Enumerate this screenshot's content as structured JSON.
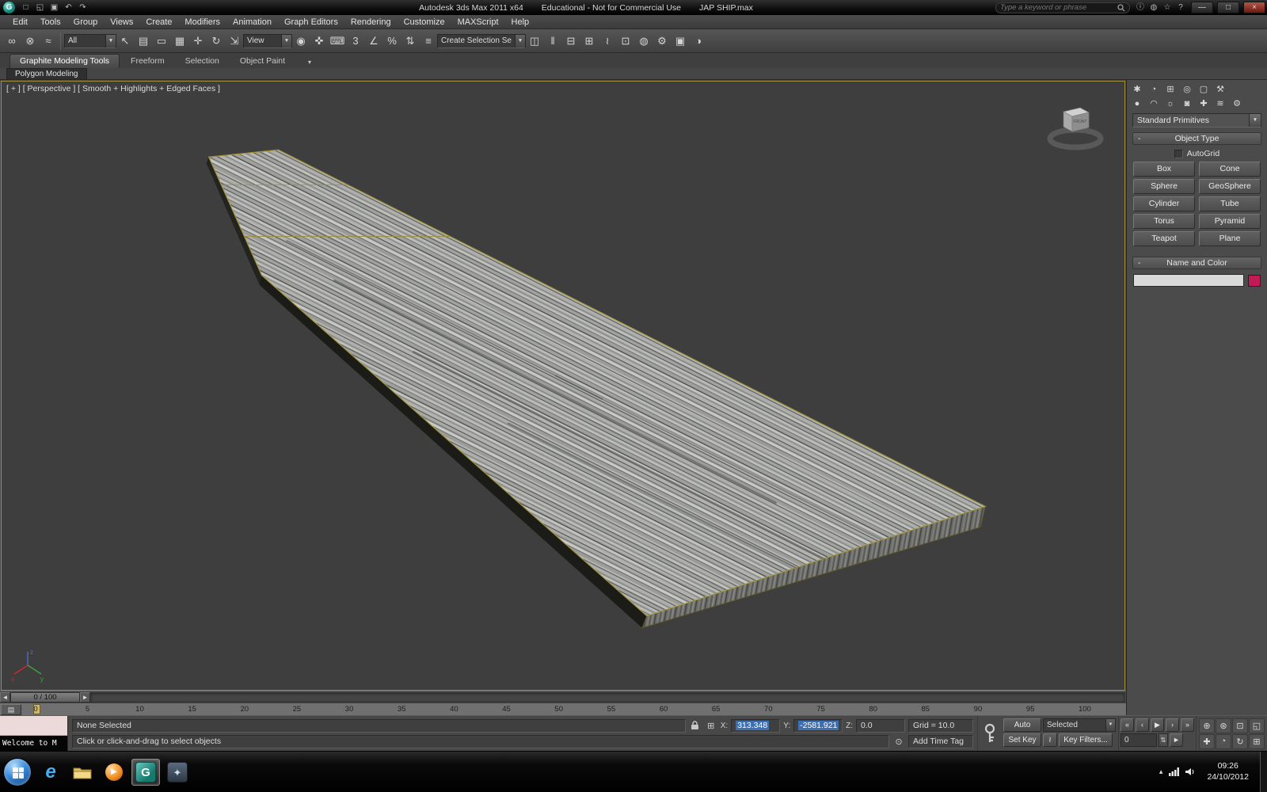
{
  "title_bar": {
    "app_title": "Autodesk 3ds Max 2011 x64",
    "license_text": "Educational - Not for Commercial Use",
    "file_name": "JAP SHIP.max",
    "search_placeholder": "Type a keyword or phrase",
    "window_buttons": {
      "minimize": "—",
      "maximize": "□",
      "close": "×"
    },
    "qa_icons": [
      {
        "name": "new-scene-icon",
        "glyph": "□"
      },
      {
        "name": "open-file-icon",
        "glyph": "◱"
      },
      {
        "name": "save-file-icon",
        "glyph": "▣"
      },
      {
        "name": "undo-icon",
        "glyph": "↶"
      },
      {
        "name": "redo-icon",
        "glyph": "↷"
      }
    ],
    "right_icons": [
      {
        "name": "infocenter-icon",
        "glyph": "ⓘ"
      },
      {
        "name": "communication-center-icon",
        "glyph": "◍"
      },
      {
        "name": "favorites-star-icon",
        "glyph": "☆"
      },
      {
        "name": "help-icon",
        "glyph": "?"
      }
    ]
  },
  "menu_bar": {
    "items": [
      "Edit",
      "Tools",
      "Group",
      "Views",
      "Create",
      "Modifiers",
      "Animation",
      "Graph Editors",
      "Rendering",
      "Customize",
      "MAXScript",
      "Help"
    ]
  },
  "toolbar": {
    "selection_filter_value": "All",
    "coord_system_value": "View",
    "named_selection_value": "Create Selection Se",
    "dropdown_arrow": "▼",
    "group1": [
      {
        "name": "select-and-link-icon",
        "glyph": "∞"
      },
      {
        "name": "unlink-selection-icon",
        "glyph": "⊗"
      },
      {
        "name": "bind-to-space-warp-icon",
        "glyph": "≈"
      }
    ],
    "group2": [
      {
        "name": "select-object-icon",
        "glyph": "↖"
      },
      {
        "name": "select-by-name-icon",
        "glyph": "▤"
      },
      {
        "name": "rectangular-selection-region-icon",
        "glyph": "▭"
      },
      {
        "name": "window-crossing-icon",
        "glyph": "▦"
      },
      {
        "name": "select-and-move-icon",
        "glyph": "✛"
      },
      {
        "name": "select-and-rotate-icon",
        "glyph": "↻"
      },
      {
        "name": "select-and-scale-icon",
        "glyph": "⇲"
      }
    ],
    "group3": [
      {
        "name": "use-pivot-point-center-icon",
        "glyph": "◉"
      },
      {
        "name": "select-and-manipulate-icon",
        "glyph": "✜"
      },
      {
        "name": "keyboard-shortcut-override-icon",
        "glyph": "⌨"
      },
      {
        "name": "snap-toggle-3d-icon",
        "glyph": "3"
      },
      {
        "name": "angle-snap-icon",
        "glyph": "∠"
      },
      {
        "name": "percent-snap-icon",
        "glyph": "%"
      },
      {
        "name": "spinner-snap-icon",
        "glyph": "⇅"
      },
      {
        "name": "edit-named-selection-sets-icon",
        "glyph": "≡"
      }
    ],
    "group4": [
      {
        "name": "mirror-icon",
        "glyph": "◫"
      },
      {
        "name": "align-icon",
        "glyph": "‖"
      },
      {
        "name": "layer-manager-icon",
        "glyph": "⊟"
      },
      {
        "name": "graphite-ribbon-toggle-icon",
        "glyph": "⊞"
      },
      {
        "name": "curve-editor-icon",
        "glyph": "≀"
      },
      {
        "name": "schematic-view-icon",
        "glyph": "⊡"
      },
      {
        "name": "material-editor-icon",
        "glyph": "◍"
      },
      {
        "name": "render-setup-icon",
        "glyph": "⚙"
      },
      {
        "name": "rendered-frame-window-icon",
        "glyph": "▣"
      },
      {
        "name": "render-production-icon",
        "glyph": "◑"
      }
    ]
  },
  "ribbon": {
    "tabs": [
      "Graphite Modeling Tools",
      "Freeform",
      "Selection",
      "Object Paint"
    ],
    "more_glyph": "▾",
    "subtab": "Polygon Modeling"
  },
  "viewport": {
    "label": "[ + ] [ Perspective ] [ Smooth + Highlights + Edged Faces ]",
    "viewcube_front_label": "FRONT",
    "axis_x_label": "x",
    "axis_y_label": "y",
    "axis_z_label": "z"
  },
  "command_panel": {
    "tab_icons": [
      {
        "name": "create-tab-icon",
        "glyph": "✱"
      },
      {
        "name": "modify-tab-icon",
        "glyph": "◔"
      },
      {
        "name": "hierarchy-tab-icon",
        "glyph": "⊞"
      },
      {
        "name": "motion-tab-icon",
        "glyph": "◎"
      },
      {
        "name": "display-tab-icon",
        "glyph": "▢"
      },
      {
        "name": "utilities-tab-icon",
        "glyph": "⚒"
      }
    ],
    "category_icons": [
      {
        "name": "geometry-category-icon",
        "glyph": "●"
      },
      {
        "name": "shapes-category-icon",
        "glyph": "◠"
      },
      {
        "name": "lights-category-icon",
        "glyph": "☼"
      },
      {
        "name": "cameras-category-icon",
        "glyph": "◙"
      },
      {
        "name": "helpers-category-icon",
        "glyph": "✚"
      },
      {
        "name": "space-warps-category-icon",
        "glyph": "≋"
      },
      {
        "name": "systems-category-icon",
        "glyph": "⚙"
      }
    ],
    "primitives_dropdown_value": "Standard Primitives",
    "object_type_rollout": {
      "collapse_glyph": "-",
      "title": "Object Type",
      "autogrid_label": "AutoGrid",
      "buttons": [
        "Box",
        "Cone",
        "Sphere",
        "GeoSphere",
        "Cylinder",
        "Tube",
        "Torus",
        "Pyramid",
        "Teapot",
        "Plane"
      ]
    },
    "name_color_rollout": {
      "collapse_glyph": "-",
      "title": "Name and Color",
      "name_value": "",
      "swatch_color": "#c21a57"
    }
  },
  "timeline": {
    "prev_glyph": "◄",
    "next_glyph": "►",
    "frame_display": "0 / 100",
    "ruler_button_glyph": "▤",
    "ticks": [
      "0",
      "5",
      "10",
      "15",
      "20",
      "25",
      "30",
      "35",
      "40",
      "45",
      "50",
      "55",
      "60",
      "65",
      "70",
      "75",
      "80",
      "85",
      "90",
      "95",
      "100"
    ]
  },
  "status_bar": {
    "none_selected": "None Selected",
    "prompt": "Click or click-and-drag to select objects",
    "coord_mode_glyph": "⊞",
    "coord": {
      "x_label": "X:",
      "x_value": "313.348",
      "y_label": "Y:",
      "y_value": "-2581.921",
      "z_label": "Z:",
      "z_value": "0.0"
    },
    "grid_label": "Grid = 10.0",
    "time_tag_icon_glyph": "⊙",
    "add_time_tag": "Add Time Tag",
    "auto_key": "Auto Key",
    "set_key": "Set Key",
    "key_mode_value": "Selected",
    "curve_button_glyph": "≀",
    "key_filters": "Key Filters...",
    "frame_value": "0",
    "frame_spinner_glyph": "⇅",
    "welcome_window_title": "Welcome to M",
    "playback_icons": [
      {
        "name": "go-to-start-button",
        "glyph": "«"
      },
      {
        "name": "previous-frame-button",
        "glyph": "‹"
      },
      {
        "name": "play-button",
        "glyph": "▶"
      },
      {
        "name": "next-frame-button",
        "glyph": "›"
      },
      {
        "name": "go-to-end-button",
        "glyph": "»"
      }
    ],
    "nav_icons_row1": [
      {
        "name": "zoom-icon",
        "glyph": "⊕"
      },
      {
        "name": "zoom-all-icon",
        "glyph": "⊛"
      },
      {
        "name": "zoom-extents-icon",
        "glyph": "⊡"
      },
      {
        "name": "zoom-region-icon",
        "glyph": "◱"
      }
    ],
    "nav_icons_row2": [
      {
        "name": "pan-icon",
        "glyph": "✚"
      },
      {
        "name": "field-of-view-icon",
        "glyph": "◔"
      },
      {
        "name": "orbit-icon",
        "glyph": "↻"
      },
      {
        "name": "maximize-viewport-toggle-icon",
        "glyph": "⊞"
      }
    ]
  },
  "taskbar": {
    "time": "09:26",
    "date": "24/10/2012",
    "tray_show_hidden_glyph": "▴"
  }
}
